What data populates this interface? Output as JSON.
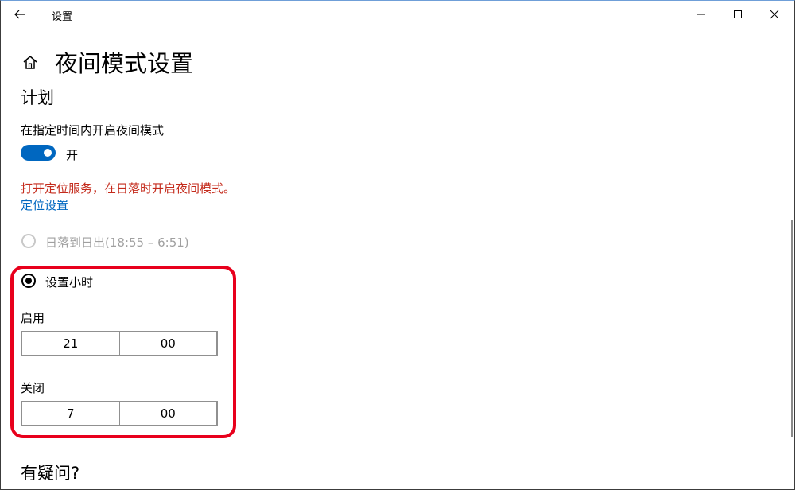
{
  "window": {
    "app_title": "设置"
  },
  "page": {
    "title": "夜间模式设置"
  },
  "schedule": {
    "heading": "计划",
    "label": "在指定时间内开启夜间模式",
    "toggle_state_text": "开",
    "toggle_on": true,
    "location_warning": "打开定位服务，在日落时开启夜间模式。",
    "location_link": "定位设置",
    "sunset_option": "日落到日出(18:55 – 6:51)",
    "custom_option": "设置小时",
    "turn_on": {
      "label": "启用",
      "hour": "21",
      "minute": "00"
    },
    "turn_off": {
      "label": "关闭",
      "hour": "7",
      "minute": "00"
    }
  },
  "faq": {
    "heading": "有疑问?"
  },
  "colors": {
    "accent": "#0067c0",
    "warning": "#c42b1c",
    "annotation": "#e8001c"
  }
}
